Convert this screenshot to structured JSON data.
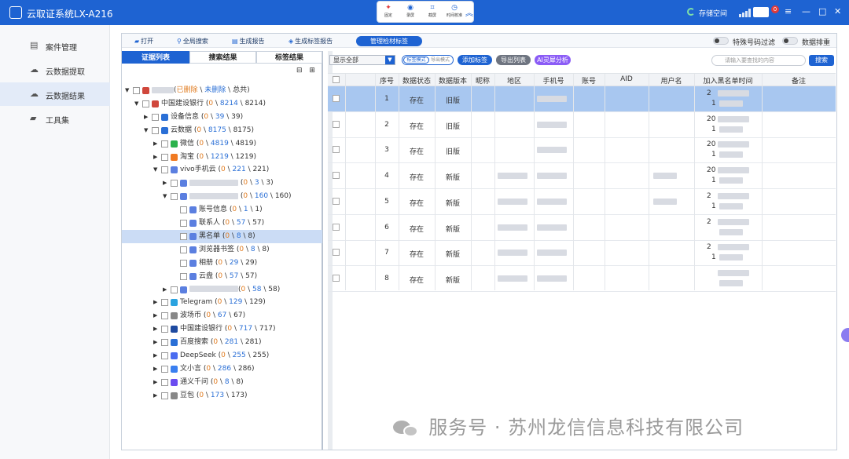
{
  "window": {
    "title": "云取证系统LX-A216",
    "storage_label": "存储空间",
    "mail_badge": "0",
    "toolpop": [
      {
        "label": "固定",
        "icon": "pin-icon"
      },
      {
        "label": "录屏",
        "icon": "record-icon"
      },
      {
        "label": "截屏",
        "icon": "crop-icon"
      },
      {
        "label": "时间校准",
        "icon": "clock-icon"
      }
    ]
  },
  "leftnav": {
    "items": [
      {
        "label": "案件管理",
        "icon": "case-icon",
        "active": false
      },
      {
        "label": "云数据提取",
        "icon": "cloud-upload-icon",
        "active": false
      },
      {
        "label": "云数据结果",
        "icon": "cloud-result-icon",
        "active": true
      },
      {
        "label": "工具集",
        "icon": "toolbox-icon",
        "active": false
      }
    ]
  },
  "toolbar": {
    "open": "打开",
    "global_search": "全局搜索",
    "gen_report": "生成报告",
    "gen_tag_report": "生成标签报告",
    "manage_tags": "管理检材标签",
    "special_filter": "特殊号码过滤",
    "data_sort": "数据排重"
  },
  "left_tabs": [
    "证据列表",
    "搜索结果",
    "标签结果"
  ],
  "tree": [
    {
      "level": 0,
      "expanded": true,
      "label_pre": "",
      "deleted": "已删除",
      "sep1": " \\ ",
      "undeleted": "未删除",
      "sep2": " \\ ",
      "total_label": "总共)",
      "blur": true,
      "open": "(",
      "icon": "#d0473c"
    },
    {
      "level": 1,
      "expanded": true,
      "name": "中国建设银行",
      "open": " (",
      "a": "0",
      "b": "8214",
      "c": "8214",
      "icon": "#d0473c"
    },
    {
      "level": 2,
      "expanded": false,
      "name": "设备信息",
      "open": " (",
      "a": "0",
      "b": "39",
      "c": "39",
      "icon": "#2a6fd6"
    },
    {
      "level": 2,
      "expanded": true,
      "name": "云数据",
      "open": " (",
      "a": "0",
      "b": "8175",
      "c": "8175",
      "icon": "#2a6fd6"
    },
    {
      "level": 3,
      "expanded": false,
      "name": "微信",
      "open": " (",
      "a": "0",
      "b": "4819",
      "c": "4819",
      "icon": "#2bb24c"
    },
    {
      "level": 3,
      "expanded": false,
      "name": "淘宝",
      "open": " (",
      "a": "0",
      "b": "1219",
      "c": "1219",
      "icon": "#f07a22"
    },
    {
      "level": 3,
      "expanded": true,
      "name": "vivo手机云",
      "open": " (",
      "a": "0",
      "b": "221",
      "c": "221",
      "icon": "#5b7fe0"
    },
    {
      "level": 4,
      "expanded": false,
      "blur": true,
      "open": " (",
      "a": "0",
      "b": "3",
      "c": "3",
      "icon": "#5b7fe0"
    },
    {
      "level": 4,
      "expanded": true,
      "blur": true,
      "open": " (",
      "a": "0",
      "b": "160",
      "c": "160",
      "icon": "#5b7fe0"
    },
    {
      "level": 5,
      "name": "账号信息",
      "open": " (",
      "a": "0",
      "b": "1",
      "c": "1",
      "icon": "#5b7fe0"
    },
    {
      "level": 5,
      "name": "联系人",
      "open": " (",
      "a": "0",
      "b": "57",
      "c": "57",
      "icon": "#5b7fe0"
    },
    {
      "level": 5,
      "name": "黑名单",
      "open": " (",
      "a": "0",
      "b": "8",
      "c": "8",
      "icon": "#5b7fe0",
      "selected": true
    },
    {
      "level": 5,
      "name": "浏览器书签",
      "open": " (",
      "a": "0",
      "b": "8",
      "c": "8",
      "icon": "#5b7fe0"
    },
    {
      "level": 5,
      "name": "相册",
      "open": " (",
      "a": "0",
      "b": "29",
      "c": "29",
      "icon": "#5b7fe0"
    },
    {
      "level": 5,
      "name": "云盘",
      "open": " (",
      "a": "0",
      "b": "57",
      "c": "57",
      "icon": "#5b7fe0"
    },
    {
      "level": 4,
      "expanded": false,
      "blur": true,
      "open": "(",
      "a": "0",
      "b": "58",
      "c": "58",
      "icon": "#5b7fe0"
    },
    {
      "level": 3,
      "expanded": false,
      "name": "Telegram",
      "open": " (",
      "a": "0",
      "b": "129",
      "c": "129",
      "icon": "#2aa3e0"
    },
    {
      "level": 3,
      "expanded": false,
      "name": "波场币",
      "open": " (",
      "a": "0",
      "b": "67",
      "c": "67",
      "icon": "#888"
    },
    {
      "level": 3,
      "expanded": false,
      "name": "中国建设银行",
      "open": " (",
      "a": "0",
      "b": "717",
      "c": "717",
      "icon": "#1e4aa0"
    },
    {
      "level": 3,
      "expanded": false,
      "name": "百度搜索",
      "open": " (",
      "a": "0",
      "b": "281",
      "c": "281",
      "icon": "#2a6fd6"
    },
    {
      "level": 3,
      "expanded": false,
      "name": "DeepSeek",
      "open": " (",
      "a": "0",
      "b": "255",
      "c": "255",
      "icon": "#4a6cf0"
    },
    {
      "level": 3,
      "expanded": false,
      "name": "文小言",
      "open": " (",
      "a": "0",
      "b": "286",
      "c": "286",
      "icon": "#3a7ff0"
    },
    {
      "level": 3,
      "expanded": false,
      "name": "通义千问",
      "open": " (",
      "a": "0",
      "b": "8",
      "c": "8",
      "icon": "#6b4cf0"
    },
    {
      "level": 3,
      "expanded": false,
      "name": "豆包",
      "open": " (",
      "a": "0",
      "b": "173",
      "c": "173",
      "icon": "#888"
    }
  ],
  "filter": {
    "display_select": "显示全部",
    "mode_on": "标签模式",
    "mode_off": "导出模式",
    "add_tag": "添加标签",
    "export_list": "导出列表",
    "ai_analysis": "AI灵犀分析",
    "search_placeholder": "请输入要查找的内容",
    "search_btn": "搜索"
  },
  "table": {
    "headers": [
      "序号",
      "数据状态",
      "数据版本",
      "昵称",
      "地区",
      "手机号",
      "账号",
      "AID",
      "用户名",
      "加入黑名单时间",
      "备注"
    ],
    "rows": [
      {
        "no": "1",
        "status": "存在",
        "version": "旧版",
        "time1": "2",
        "time2": "1",
        "sel": true
      },
      {
        "no": "2",
        "status": "存在",
        "version": "旧版",
        "time1": "20",
        "time2": "1"
      },
      {
        "no": "3",
        "status": "存在",
        "version": "旧版",
        "time1": "20",
        "time2": "1"
      },
      {
        "no": "4",
        "status": "存在",
        "version": "新版",
        "time1": "20",
        "time2": "1"
      },
      {
        "no": "5",
        "status": "存在",
        "version": "新版",
        "time1": "2",
        "time2": "1"
      },
      {
        "no": "6",
        "status": "存在",
        "version": "新版",
        "time1": "2",
        "time2": ""
      },
      {
        "no": "7",
        "status": "存在",
        "version": "新版",
        "time1": "2",
        "time2": "1"
      },
      {
        "no": "8",
        "status": "存在",
        "version": "新版",
        "time1": "",
        "time2": ""
      }
    ]
  },
  "watermark": "服务号 · 苏州龙信信息科技有限公司",
  "colors": {
    "accent": "#1e63d2",
    "deleted": "#e07b1f",
    "count": "#2a6fd6",
    "selected_row": "#a8c7f0"
  }
}
